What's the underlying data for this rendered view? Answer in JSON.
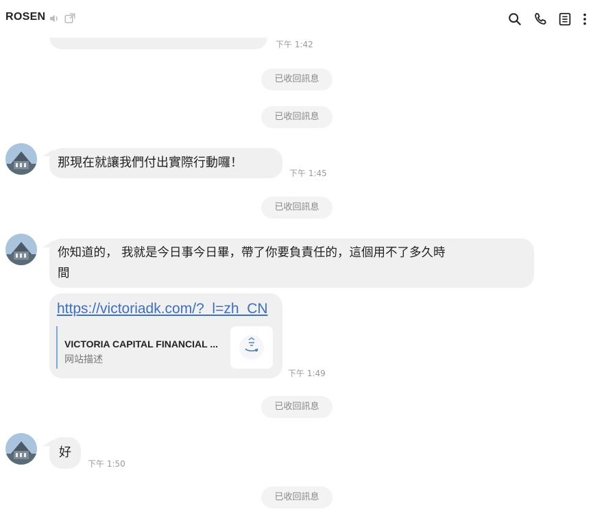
{
  "header": {
    "title": "ROSEN",
    "icons": [
      "speaker-icon",
      "external-window-icon",
      "search-icon",
      "phone-icon",
      "notes-icon",
      "more-icon"
    ]
  },
  "messages": {
    "top_partial_time": "下午 1:42",
    "recall_text": "已收回訊息",
    "m1": {
      "text": "那現在就讓我們付出實際行動囉！",
      "time": "下午 1:45"
    },
    "m2": {
      "line1": "你知道的， 我就是今日事今日畢，帶了你要負責任的，這個用不了多久時",
      "line2": "間"
    },
    "m3": {
      "url": "https://victoriadk.com/?_l=zh_CN",
      "preview_title": "VICTORIA CAPITAL FINANCIAL ...",
      "preview_desc": "网站描述",
      "time": "下午 1:49"
    },
    "m4": {
      "text": "好",
      "time": "下午 1:50"
    }
  },
  "colors": {
    "bubble": "#f0f0f0",
    "pill": "#f3f3f3",
    "link": "#3a6fc4",
    "preview_border": "#7aa6dd"
  }
}
